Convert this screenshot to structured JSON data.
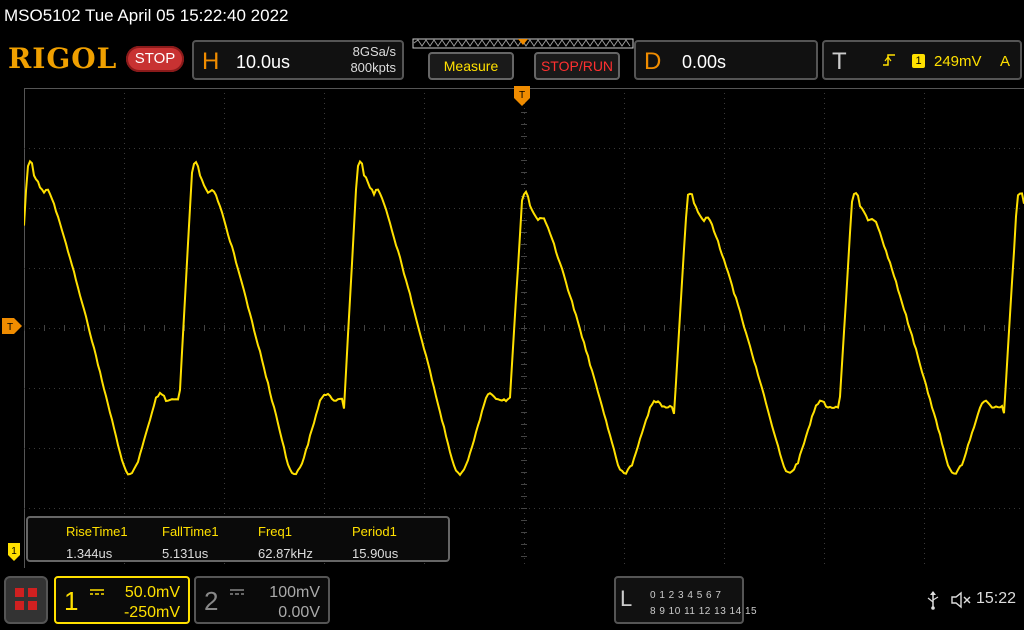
{
  "titlebar": {
    "text": "MSO5102  Tue April 05 15:22:40 2022"
  },
  "toolbar": {
    "logo": "RIGOL",
    "run_state": "STOP",
    "horizontal": {
      "letter": "H",
      "timebase": "10.0us",
      "sample_rate": "8GSa/s",
      "memory_depth": "800kpts"
    },
    "measure_button": "Measure",
    "stoprun_button": "STOP/RUN",
    "delay": {
      "letter": "D",
      "value": "0.00s"
    },
    "trigger": {
      "letter": "T",
      "source": "1",
      "level": "249mV",
      "mode": "A"
    }
  },
  "screen_markers": {
    "trigger_top": "T",
    "trigger_left": "T",
    "ch1": "1"
  },
  "measurements": {
    "headers": [
      "RiseTime1",
      "FallTime1",
      "Freq1",
      "Period1"
    ],
    "values": [
      "1.344us",
      "5.131us",
      "62.87kHz",
      "15.90us"
    ]
  },
  "channels": {
    "ch1": {
      "number": "1",
      "scale": "50.0mV",
      "offset": "-250mV",
      "color": "#ffe000"
    },
    "ch2": {
      "number": "2",
      "scale": "100mV",
      "offset": "0.00V",
      "color": "#888888"
    }
  },
  "logic_analyzer": {
    "letter": "L",
    "row1": "0 1 2 3   4 5 6 7",
    "row2": "8 9 10 11 12 13 14 15"
  },
  "statusbar": {
    "time": "15:22",
    "usb_icon": "usb-icon",
    "speaker_icon": "speaker-muted-icon"
  },
  "colors": {
    "accent": "#f08c00",
    "trace": "#ffe000",
    "grid": "#3a3a3a",
    "stop": "#c83232"
  }
}
